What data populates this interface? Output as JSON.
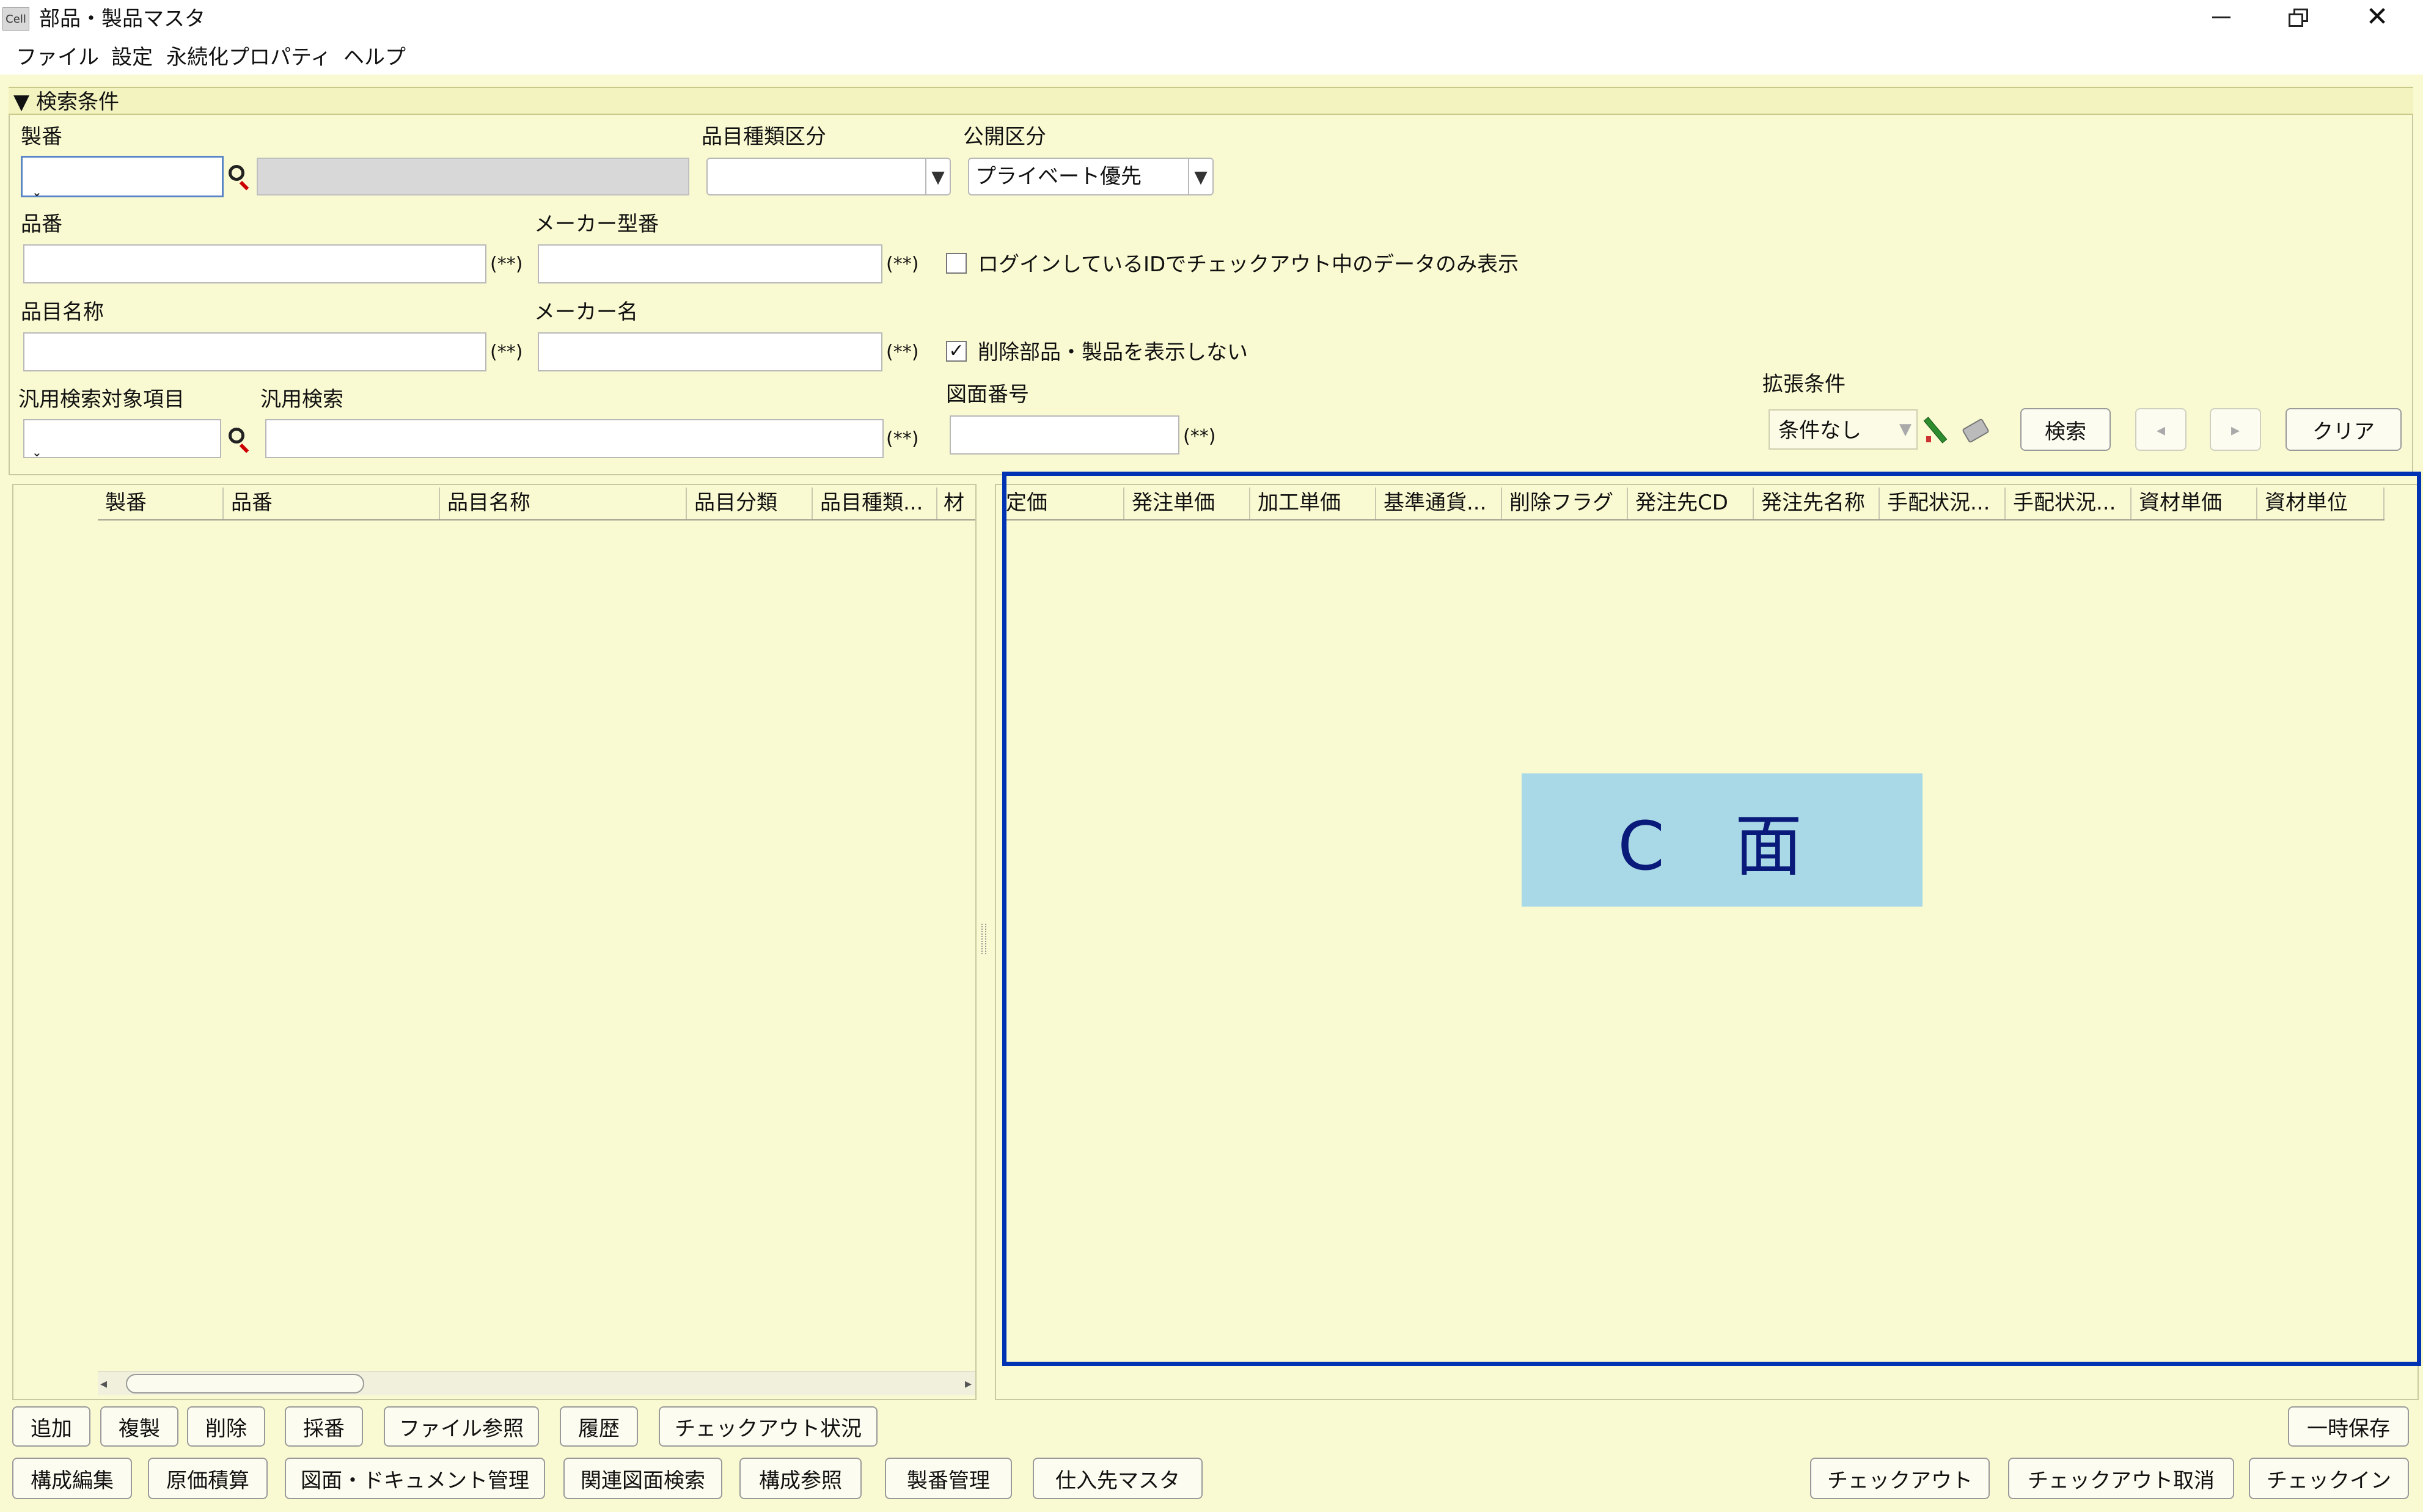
{
  "window": {
    "app_icon": "Cell",
    "title": "部品・製品マスタ",
    "controls": [
      "minimize-icon",
      "restore-icon",
      "close-icon"
    ]
  },
  "menu": [
    "ファイル",
    "設定",
    "永続化プロパティ",
    "ヘルプ"
  ],
  "search": {
    "section_title": "▼ 検索条件",
    "seiban_label": "製番",
    "hinmoku_kind_label": "品目種類区分",
    "kokai_label": "公開区分",
    "kokai_value": "プライベート優先",
    "hinban_label": "品番",
    "maker_model_label": "メーカー型番",
    "checkout_only_label": "ログインしているIDでチェックアウト中のデータのみ表示",
    "hinmoku_name_label": "品目名称",
    "maker_name_label": "メーカー名",
    "hide_deleted_label": "削除部品・製品を表示しない",
    "general_target_label": "汎用検索対象項目",
    "general_search_label": "汎用検索",
    "drawing_no_label": "図面番号",
    "ext_label": "拡張条件",
    "ext_value": "条件なし",
    "wildcard_note": "(**)",
    "search_button": "検索",
    "prev_button": "◂",
    "next_button": "▸",
    "clear_button": "クリア"
  },
  "left_table": {
    "columns": [
      "製番",
      "品番",
      "品目名称",
      "品目分類",
      "品目種類...",
      "材"
    ]
  },
  "right_table": {
    "columns": [
      "定価",
      "発注単価",
      "加工単価",
      "基準通貨...",
      "削除フラグ",
      "発注先CD",
      "発注先名称",
      "手配状況...",
      "手配状況...",
      "資材単価",
      "資材単位"
    ]
  },
  "overlay_label": "C 面",
  "buttons_row1": [
    "追加",
    "複製",
    "削除",
    "採番",
    "ファイル参照",
    "履歴",
    "チェックアウト状況"
  ],
  "temp_save_button": "一時保存",
  "buttons_row2": [
    "構成編集",
    "原価積算",
    "図面・ドキュメント管理",
    "関連図面検索",
    "構成参照",
    "製番管理",
    "仕入先マスタ"
  ],
  "checkout_buttons": [
    "チェックアウト",
    "チェックアウト取消",
    "チェックイン"
  ],
  "colors": {
    "background": "#fafad2",
    "highlight_border": "#0033b3",
    "overlay_bg": "#a9d8e6",
    "overlay_text": "#0a1a7a"
  }
}
